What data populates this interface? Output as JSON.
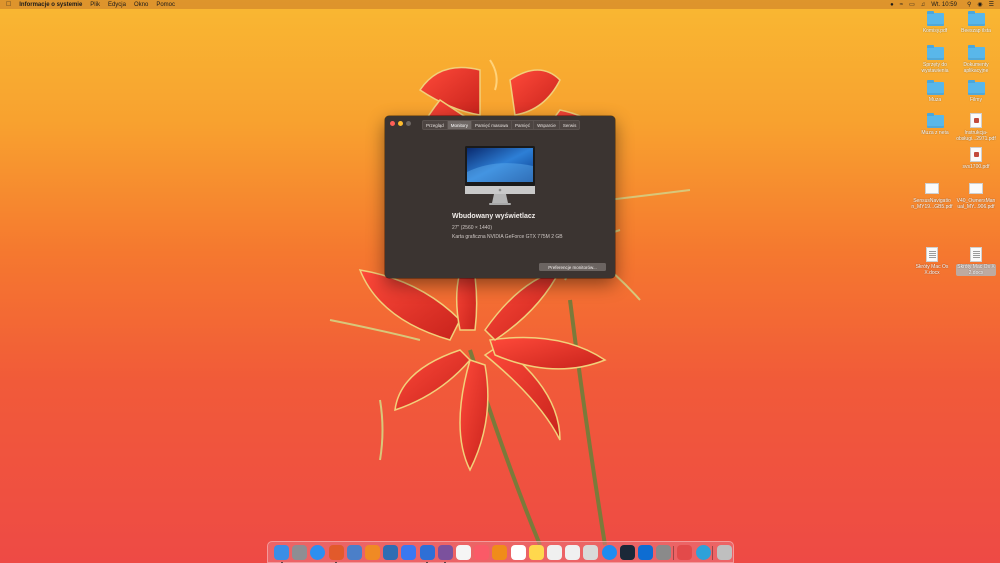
{
  "menubar": {
    "apple_icon": "apple-logo",
    "app_name": "Informacje o systemie",
    "menus": [
      "Plik",
      "Edycja",
      "Okno",
      "Pomoc"
    ],
    "clock": "Wt. 10:59"
  },
  "desktop_icons": [
    {
      "label": "Komisy.pdf",
      "kind": "folder"
    },
    {
      "label": "Beeszap ilsta",
      "kind": "folder"
    },
    {
      "label": "Sprzęty do\nwystawienia",
      "kind": "folder"
    },
    {
      "label": "Dokumenty\naplikacyjne",
      "kind": "folder"
    },
    {
      "label": "Muza",
      "kind": "folder"
    },
    {
      "label": "Filmy",
      "kind": "folder"
    },
    {
      "label": "Muza z neta",
      "kind": "folder"
    },
    {
      "label": "Instrukcja-\nobsługi...2971.pdf",
      "kind": "pdf"
    },
    {
      "label": "svs1700.pdf",
      "kind": "pdf"
    },
    {
      "label": "SensusNavigatio\nn_MY19...GB5.pdf",
      "kind": "pdf-wide"
    },
    {
      "label": "V40_OwnersMan\nual_MY...906.pdf",
      "kind": "pdf-wide"
    },
    {
      "label": "Skróty Mac Os\nX.docx",
      "kind": "word"
    },
    {
      "label": "Skróty Mac Os X\n2.docx",
      "kind": "word"
    }
  ],
  "window": {
    "tabs": [
      "Przegląd",
      "Monitory",
      "Pamięć masowa",
      "Pamięć",
      "Wsparcie",
      "Serwis"
    ],
    "active_tab": "Monitory",
    "display_name": "Wbudowany wyświetlacz",
    "resolution": "27\" (2560 × 1440)",
    "gpu": "Karta graficzna NVIDIA GeForce GTX 775M 2  GB",
    "prefs_button": "Preferencje monitorów..."
  },
  "dock": {
    "items": [
      {
        "name": "finder-icon",
        "color": "#3a8ee6"
      },
      {
        "name": "launchpad-icon",
        "color": "#8e8e93"
      },
      {
        "name": "safari-icon",
        "color": "#2d8ff0"
      },
      {
        "name": "firefox-icon",
        "color": "#e25a2b"
      },
      {
        "name": "preview-icon",
        "color": "#4b7fc9"
      },
      {
        "name": "app-icon",
        "color": "#f08a24"
      },
      {
        "name": "app-icon-2",
        "color": "#2f6db3"
      },
      {
        "name": "messenger-icon",
        "color": "#3b78f0"
      },
      {
        "name": "messages-icon",
        "color": "#2e6fd6"
      },
      {
        "name": "viber-icon",
        "color": "#7b519d"
      },
      {
        "name": "photos-icon",
        "color": "#f5f5f5"
      },
      {
        "name": "music-icon",
        "color": "#fa5a67"
      },
      {
        "name": "vlc-icon",
        "color": "#f08c1a"
      },
      {
        "name": "calendar-icon",
        "color": "#ffffff"
      },
      {
        "name": "notes-icon",
        "color": "#ffd84d"
      },
      {
        "name": "textedit-icon",
        "color": "#f0f0f0"
      },
      {
        "name": "word-icon",
        "color": "#f0f0f0"
      },
      {
        "name": "preview-2-icon",
        "color": "#d9d9d9"
      },
      {
        "name": "app-store-icon",
        "color": "#1f8cf0"
      },
      {
        "name": "steam-icon",
        "color": "#1b2838"
      },
      {
        "name": "teamviewer-icon",
        "color": "#0e6dd2"
      },
      {
        "name": "system-preferences-icon",
        "color": "#8a8a8a"
      },
      {
        "name": "teamviewer-2-icon",
        "color": "#e34a4a"
      },
      {
        "name": "globe-icon",
        "color": "#2ea1d9"
      },
      {
        "name": "trash-icon",
        "color": "#bfbfbf"
      }
    ]
  },
  "colors": {
    "window_bg": "#3b3431",
    "active_tab": "#6f6865",
    "folder": "#59b7ea"
  }
}
